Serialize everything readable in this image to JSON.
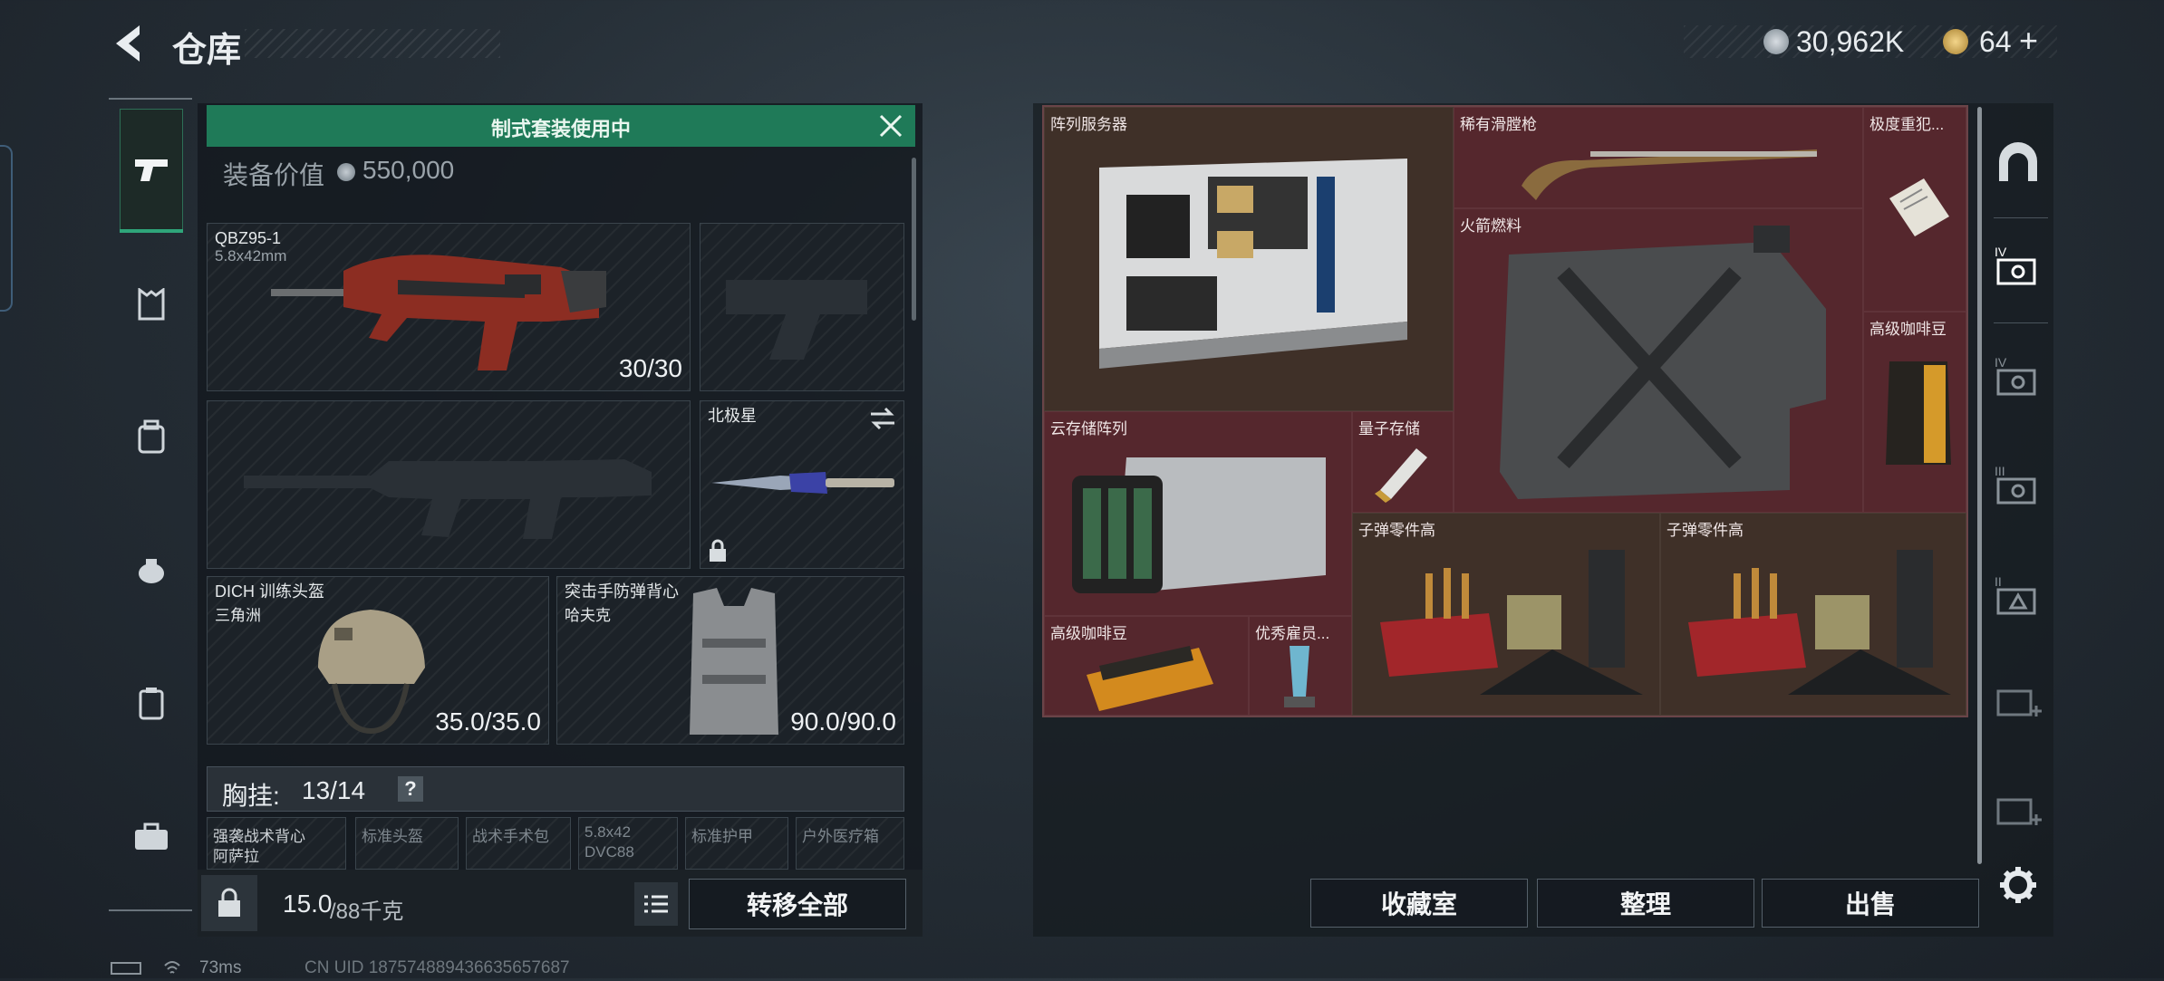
{
  "header": {
    "back_icon": "back-arrow-icon",
    "title": "仓库",
    "currency1_value": "30,962K",
    "currency2_value": "64",
    "currency2_plus": "+"
  },
  "loadout": {
    "banner_text": "制式套装使用中",
    "value_label": "装备价值",
    "value_amount": "550,000",
    "primary_weapon": {
      "name": "QBZ95-1",
      "ammo_type": "5.8x42mm",
      "ammo": "30/30"
    },
    "melee": {
      "name": "北极星"
    },
    "helmet": {
      "name": "DICH 训练头盔",
      "sub": "三角洲",
      "durability": "35.0/35.0"
    },
    "armor": {
      "name": "突击手防弹背心",
      "sub": "哈夫克",
      "durability": "90.0/90.0"
    },
    "chest_rig_label": "胸挂:",
    "chest_rig_value": "13/14",
    "chest_help": "?",
    "sub_items": [
      "强袭战术背心",
      "标准头盔",
      "战术手术包",
      "5.8x42",
      "标准护甲",
      "户外医疗箱"
    ],
    "sub_item0_sub": "阿萨拉",
    "sub_item3_sub": "DVC88",
    "weight_current": "15.0",
    "weight_max": "/88千克",
    "transfer_all": "转移全部"
  },
  "stash": {
    "items": {
      "server": "阵列服务器",
      "rifle": "稀有滑膛枪",
      "file": "极度重犯...",
      "fuel": "火箭燃料",
      "coffee1": "高级咖啡豆",
      "cloud": "云存储阵列",
      "quantum": "量子存储",
      "ammo1": "子弹零件高",
      "ammo2": "子弹零件高",
      "coffee2": "高级咖啡豆",
      "award": "优秀雇员..."
    },
    "buttons": {
      "collection": "收藏室",
      "sort": "整理",
      "sell": "出售"
    }
  },
  "status": {
    "ping": "73ms",
    "uid": "CN UID 18757488943663565​7687"
  },
  "colors": {
    "accent_green": "#1f7a58",
    "stash_red": "#5a2a30",
    "stash_brown": "#4a3530"
  }
}
